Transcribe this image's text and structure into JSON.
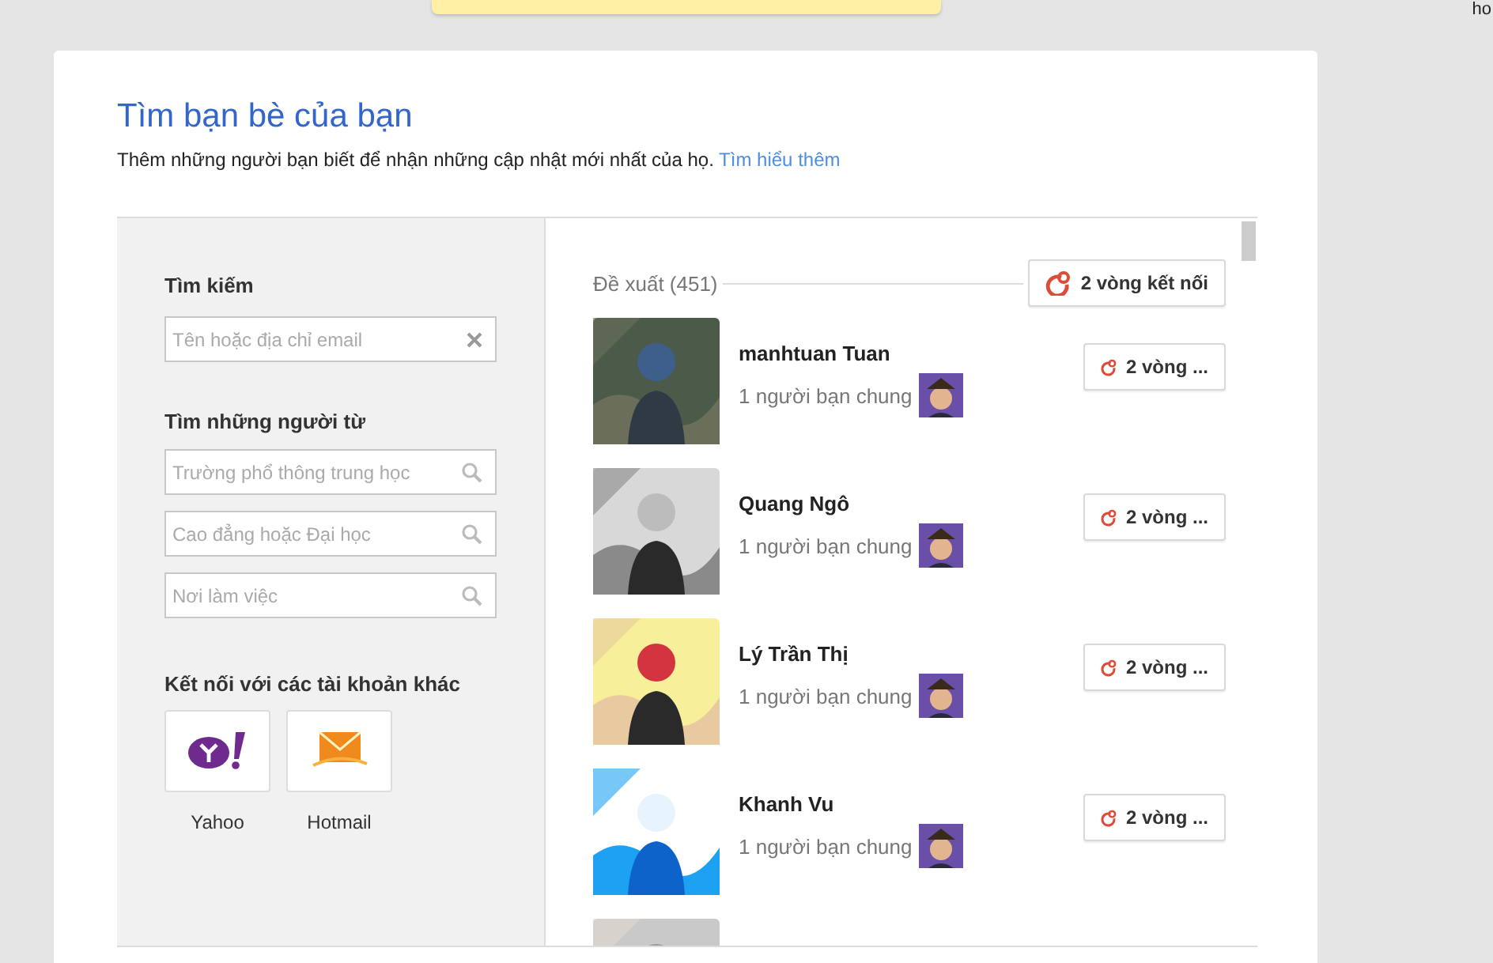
{
  "corner_text": "ho",
  "title": "Tìm bạn bè của bạn",
  "subtitle": "Thêm những người bạn biết để nhận những cập nhật mới nhất của họ.",
  "learn_more": "Tìm hiểu thêm",
  "search": {
    "heading": "Tìm kiếm",
    "placeholder": "Tên hoặc địa chỉ email"
  },
  "find_from": {
    "heading": "Tìm những người từ",
    "fields": [
      {
        "placeholder": "Trường phổ thông trung học"
      },
      {
        "placeholder": "Cao đẳng hoặc Đại học"
      },
      {
        "placeholder": "Nơi làm việc"
      }
    ]
  },
  "connect": {
    "heading": "Kết nối với các tài khoản khác",
    "accounts": [
      {
        "kind": "yahoo",
        "label": "Yahoo"
      },
      {
        "kind": "hotmail",
        "label": "Hotmail"
      }
    ]
  },
  "suggestions": {
    "heading": "Đề xuất (451)",
    "circles_button": "2 vòng kết nối",
    "people": [
      {
        "kind": "picture",
        "name": "manhtuan Tuan",
        "mutual": "1 người bạn chung",
        "button": "2 vòng ..."
      },
      {
        "kind": "picture",
        "name": "Quang Ngô",
        "mutual": "1 người bạn chung",
        "button": "2 vòng ..."
      },
      {
        "kind": "picture",
        "name": "Lý Trần Thị",
        "mutual": "1 người bạn chung",
        "button": "2 vòng ..."
      },
      {
        "kind": "picture",
        "name": "Khanh Vu",
        "mutual": "1 người bạn chung",
        "button": "2 vòng ..."
      },
      {
        "kind": "picture"
      }
    ]
  }
}
